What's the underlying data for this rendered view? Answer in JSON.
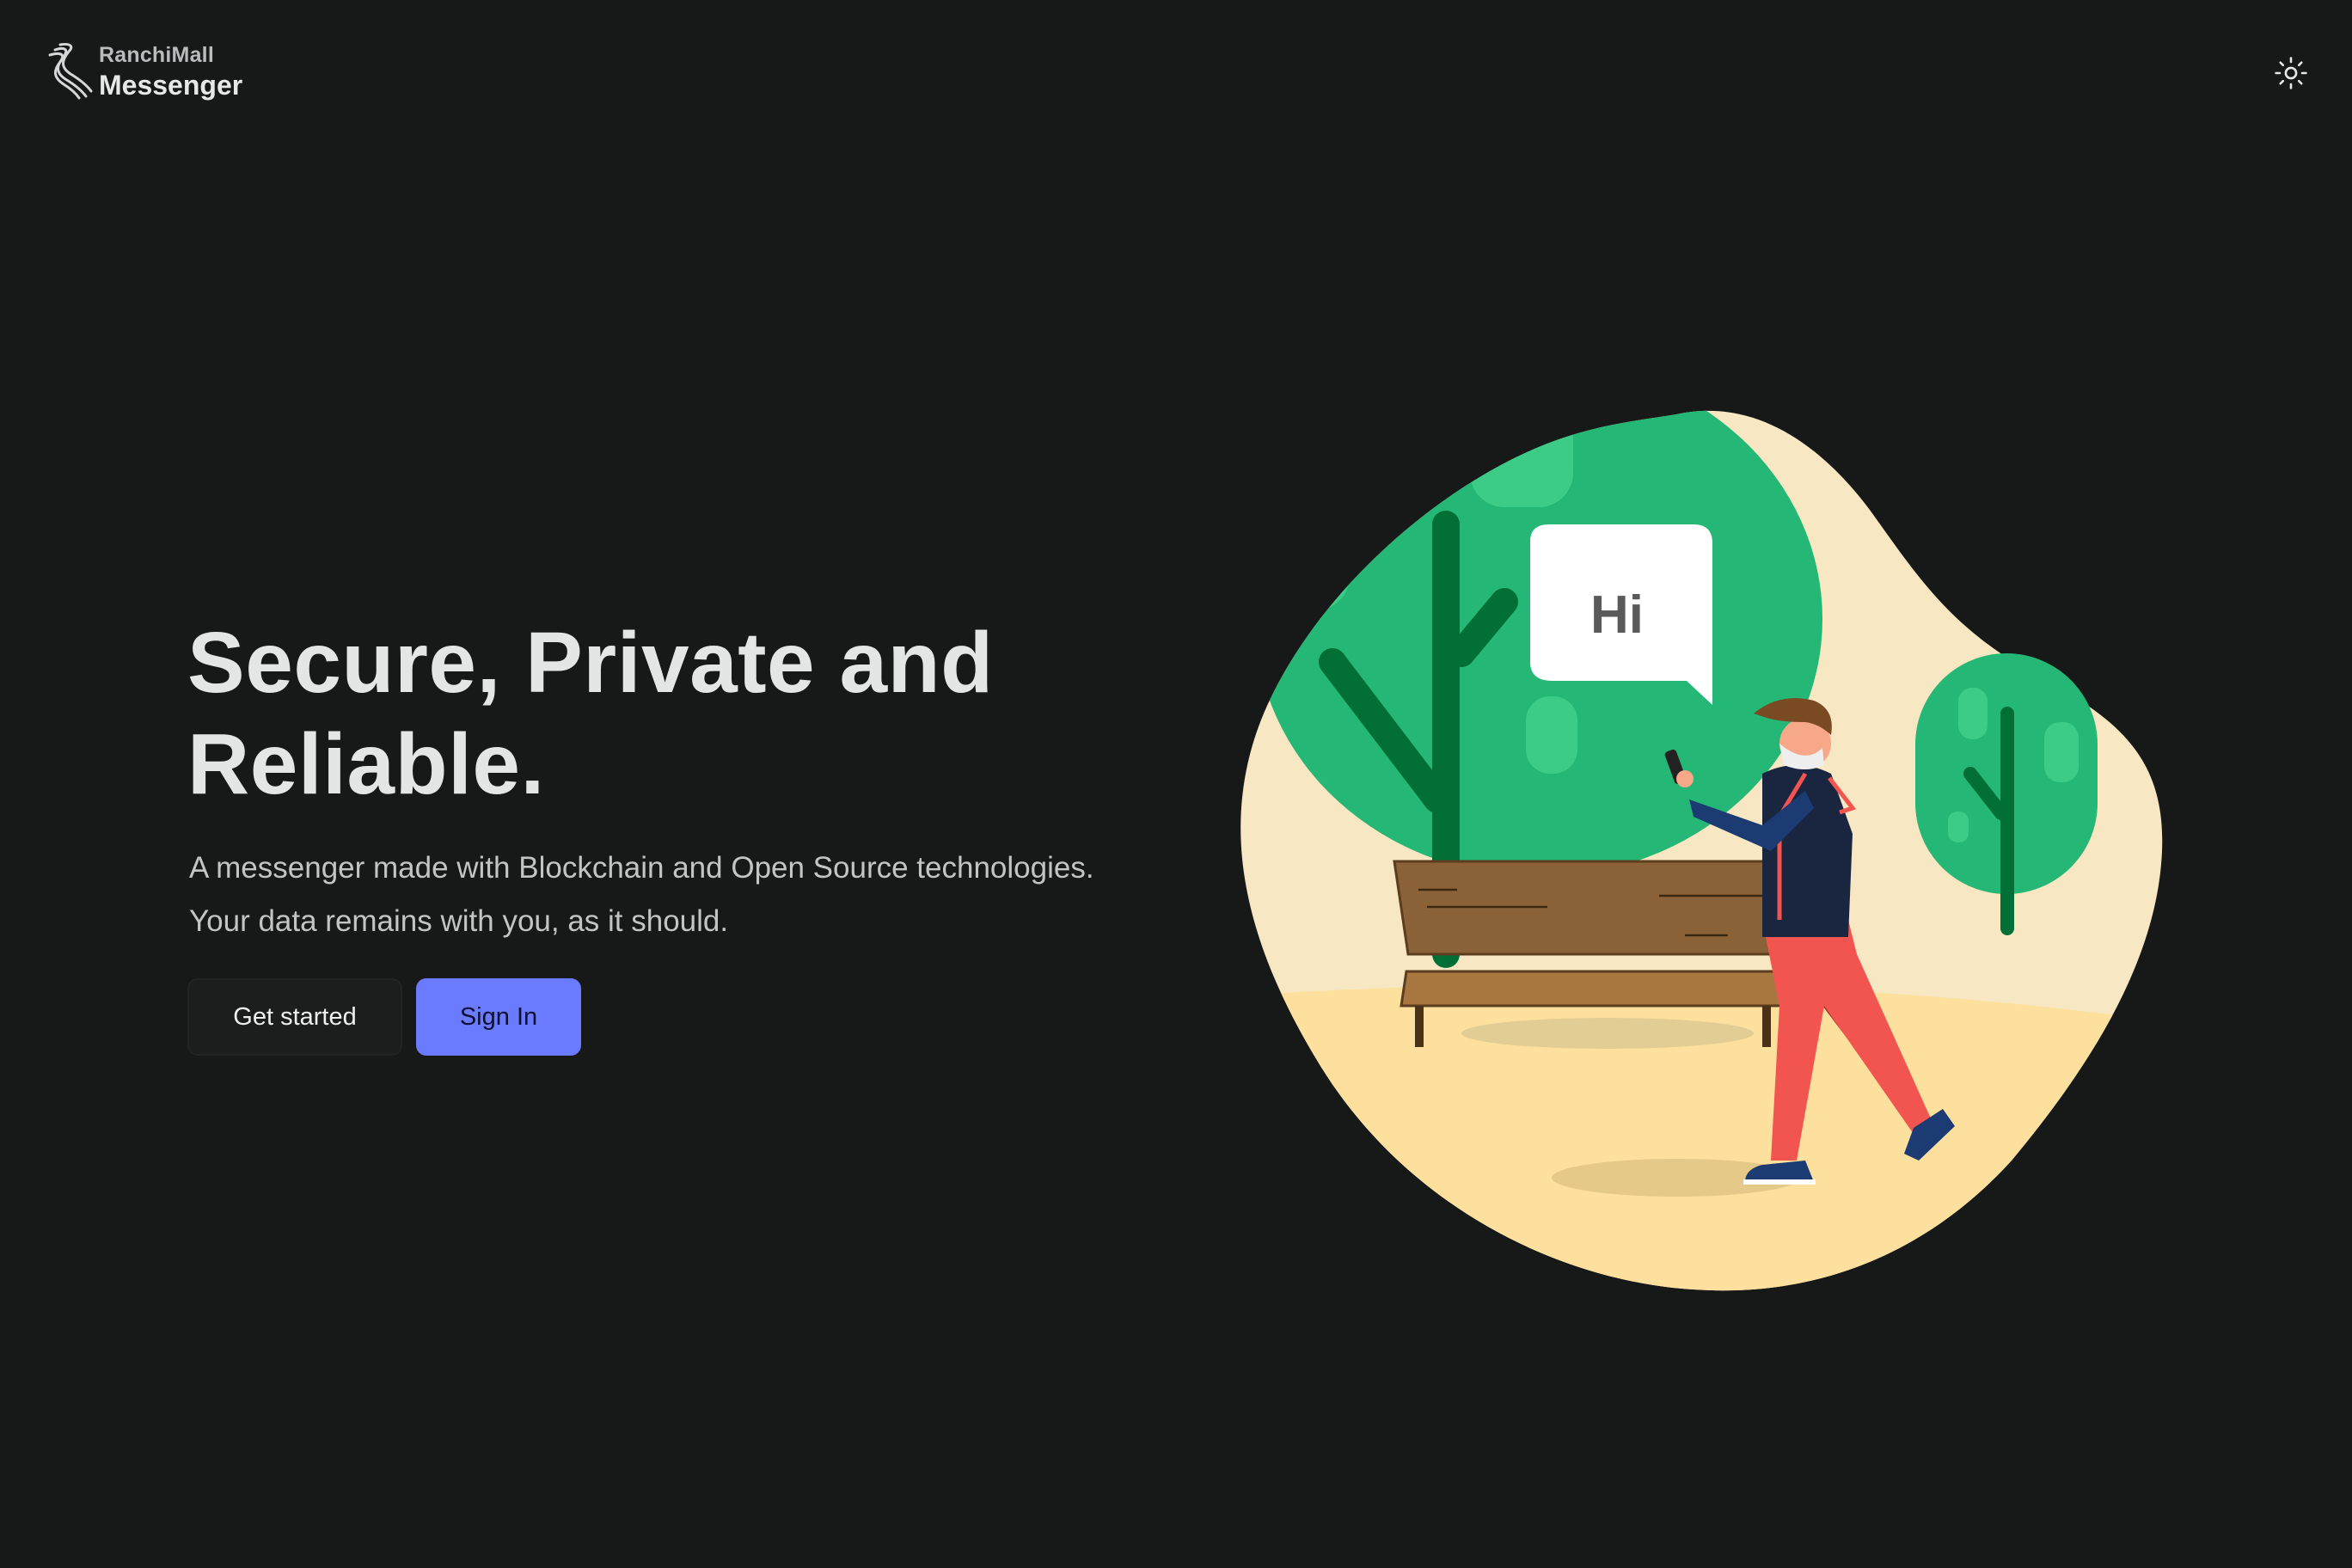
{
  "header": {
    "brand_small": "RanchiMall",
    "brand_big": "Messenger",
    "logo_icon": "ranchimall-logo-icon",
    "theme_toggle_icon": "sun-icon"
  },
  "hero": {
    "title_line1": "Secure, Private and",
    "title_line2": "Reliable.",
    "subtitle_line1": "A messenger made with Blockchain and Open Source technologies.",
    "subtitle_line2": "Your data remains with you, as it should."
  },
  "buttons": {
    "get_started": "Get started",
    "sign_in": "Sign In"
  },
  "illustration": {
    "bubble_text": "Hi",
    "icon": "person-walking-with-phone-illustration"
  },
  "colors": {
    "background": "#171818",
    "accent": "#6b7bff",
    "text": "#e4e6e6",
    "tree_green": "#25b775",
    "blob_cream": "#f7e8c3"
  }
}
